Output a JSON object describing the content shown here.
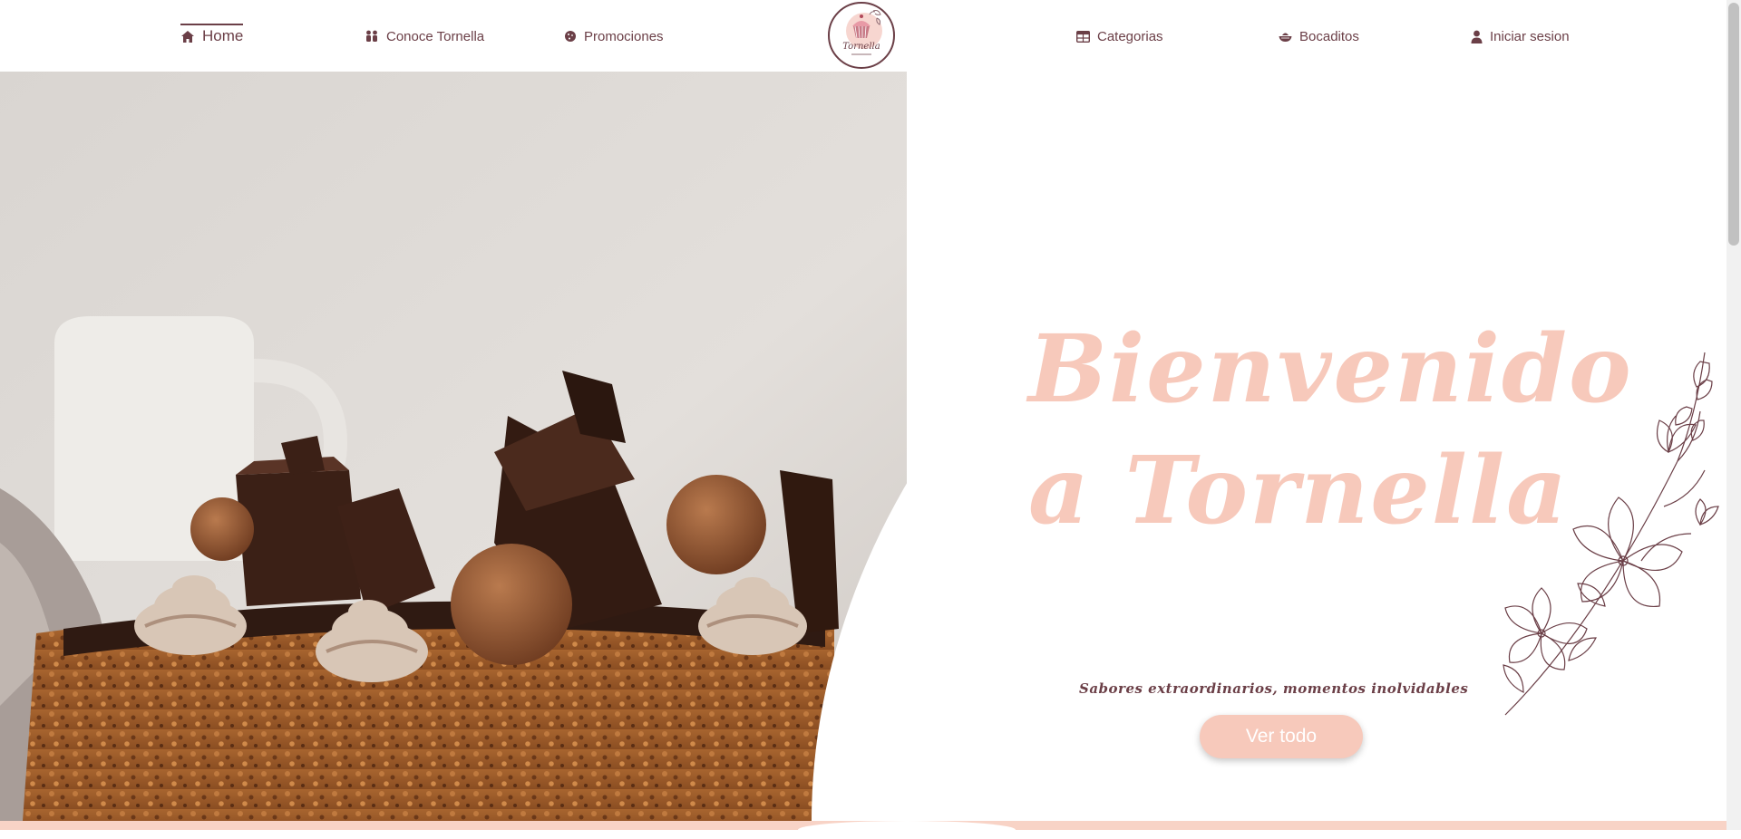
{
  "nav": {
    "items": [
      {
        "label": "Home",
        "icon": "home-icon",
        "active": true
      },
      {
        "label": "Conoce Tornella",
        "icon": "people-icon",
        "active": false
      },
      {
        "label": "Promociones",
        "icon": "cookie-icon",
        "active": false
      },
      {
        "label": "Categorias",
        "icon": "table-icon",
        "active": false
      },
      {
        "label": "Bocaditos",
        "icon": "bowl-icon",
        "active": false
      },
      {
        "label": "Iniciar sesion",
        "icon": "user-icon",
        "active": false
      }
    ],
    "logo": {
      "text": "Tornella",
      "icon": "cupcake-icon"
    }
  },
  "hero": {
    "title": "Bienvenido a Tornella",
    "subtitle": "Sabores extraordinarios, momentos inolvidables",
    "cta_label": "Ver todo",
    "image": "chocolate-cake-photo",
    "decoration": "flower-line-art"
  },
  "colors": {
    "accent": "#6b3f47",
    "title_pink": "#f7c9bb",
    "button_pink": "#f7c9bb",
    "strip_pink": "#f8d3c6",
    "background": "#ffffff"
  }
}
